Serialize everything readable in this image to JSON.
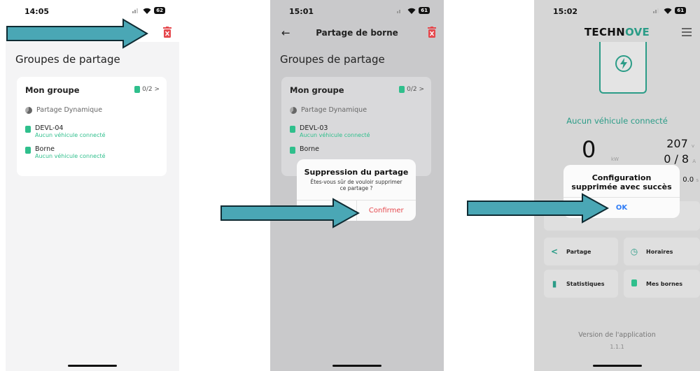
{
  "screen1": {
    "time": "14:05",
    "battery": "62",
    "title": "Groupes de partage",
    "group": {
      "name": "Mon groupe",
      "count": "0/2 >",
      "mode": "Partage Dynamique",
      "devices": [
        {
          "name": "DEVL-04",
          "status": "Aucun véhicule connecté"
        },
        {
          "name": "Borne",
          "status": "Aucun véhicule connecté"
        }
      ]
    }
  },
  "screen2": {
    "time": "15:01",
    "battery": "61",
    "appbar_title": "Partage de borne",
    "title": "Groupes de partage",
    "group": {
      "name": "Mon groupe",
      "count": "0/2 >",
      "mode": "Partage Dynamique",
      "devices": [
        {
          "name": "DEVL-03",
          "status": "Aucun véhicule connecté"
        },
        {
          "name": "Borne",
          "status": ""
        }
      ]
    },
    "dialog": {
      "title": "Suppression du partage",
      "message": "Êtes-vous sûr de vouloir supprimer ce partage ?",
      "cancel": "",
      "confirm": "Confirmer"
    }
  },
  "screen3": {
    "time": "15:02",
    "battery": "61",
    "logo_a": "TECHN",
    "logo_b": "OVE",
    "status": "Aucun véhicule connecté",
    "power": "0",
    "power_unit": "kW",
    "voltage": "207",
    "voltage_unit": "v",
    "current": "0 / 8",
    "current_unit": "A",
    "duration": "0.0",
    "duration_unit": "s",
    "dialog": {
      "title": "Configuration supprimée avec succès",
      "ok": "OK"
    },
    "tiles": [
      {
        "label": "Partage",
        "icon": "share-icon"
      },
      {
        "label": "Horaires",
        "icon": "clock-icon"
      },
      {
        "label": "Statistiques",
        "icon": "bar-chart-icon"
      },
      {
        "label": "Mes bornes",
        "icon": "charger-icon"
      }
    ],
    "version_label": "Version de l'application",
    "version": "1.1.1"
  },
  "colors": {
    "accent": "#2b9c87",
    "arrow": "#4aa7b5",
    "danger": "#e5484d",
    "link": "#2f7cf6"
  }
}
